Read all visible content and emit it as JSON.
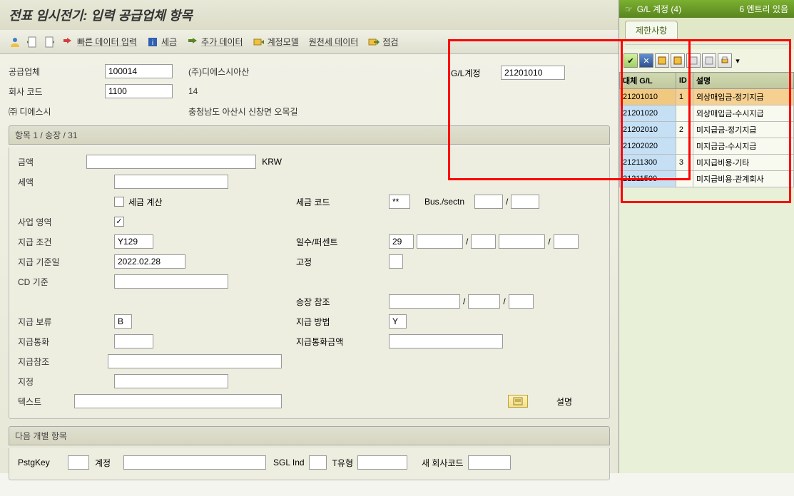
{
  "title": "전표 임시전기: 입력 공급업체 항목",
  "toolbar": {
    "fast_data": "빠른 데이터 입력",
    "tax": "세금",
    "more_data": "추가 데이터",
    "account_model": "계정모델",
    "withholding": "원천세 데이터",
    "check": "점검"
  },
  "header": {
    "vendor_label": "공급업체",
    "vendor_value": "100014",
    "vendor_name": "(주)디에스시아산",
    "company_label": "회사 코드",
    "company_value": "1100",
    "company_num": "14",
    "company_short_label": "㈜ 디에스시",
    "address": "충청남도 아산시 신창면 오목길",
    "gl_account_label": "G/L계정",
    "gl_account_value": "21201010"
  },
  "section1": {
    "title": "항목 1 / 송장 / 31",
    "amount_label": "금액",
    "currency": "KRW",
    "tax_amount_label": "세액",
    "tax_calc_label": "세금 계산",
    "tax_code_label": "세금 코드",
    "tax_code_value": "**",
    "bus_sectn_label": "Bus./sectn",
    "biz_area_label": "사업 영역",
    "pay_terms_label": "지급 조건",
    "pay_terms_value": "Y129",
    "days_percent_label": "일수/퍼센트",
    "days_value": "29",
    "baseline_date_label": "지급 기준일",
    "baseline_date_value": "2022.02.28",
    "fixed_label": "고정",
    "cd_base_label": "CD 기준",
    "invoice_ref_label": "송장 참조",
    "pay_block_label": "지급 보류",
    "pay_block_value": "B",
    "pay_method_label": "지급 방법",
    "pay_method_value": "Y",
    "pay_curr_label": "지급통화",
    "pay_curr_amt_label": "지급통화금액",
    "pay_ref_label": "지급참조",
    "assignment_label": "지정",
    "text_label": "텍스트",
    "desc_button": "설명"
  },
  "section2": {
    "title": "다음 개별 항목",
    "pstgkey_label": "PstgKey",
    "account_label": "계정",
    "sgl_ind_label": "SGL Ind",
    "ttype_label": "T유형",
    "new_company_label": "새 회사코드"
  },
  "popup": {
    "title": "G/L 계정 (4)",
    "count": "6 엔트리 있음",
    "tab": "제한사항",
    "columns": {
      "gl": "대체 G/L",
      "id": "ID",
      "desc": "설명"
    },
    "rows": [
      {
        "gl": "21201010",
        "id": "1",
        "desc": "외상매입금-정기지급",
        "selected": true
      },
      {
        "gl": "21201020",
        "id": "",
        "desc": "외상매입금-수시지급",
        "selected": false
      },
      {
        "gl": "21202010",
        "id": "2",
        "desc": "미지급금-정기지급",
        "selected": false
      },
      {
        "gl": "21202020",
        "id": "",
        "desc": "미지급금-수시지급",
        "selected": false
      },
      {
        "gl": "21211300",
        "id": "3",
        "desc": "미지급비용-기타",
        "selected": false
      },
      {
        "gl": "21211500",
        "id": "",
        "desc": "미지급비용-관계회사",
        "selected": false
      }
    ]
  }
}
